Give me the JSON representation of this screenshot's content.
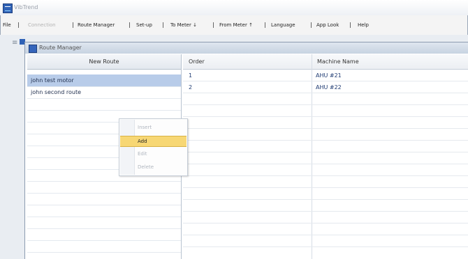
{
  "app": {
    "title": "VibTrend"
  },
  "menu": {
    "file": "File",
    "connection": "Connection",
    "route_manager": "Route Manager",
    "setup": "Set-up",
    "to_meter": "To Meter ↓",
    "from_meter": "From Meter ↑",
    "language": "Language",
    "app_look": "App Look",
    "help": "Help",
    "separator": "|"
  },
  "window": {
    "title": "Route Manager"
  },
  "routes": {
    "header": "New Route",
    "items": [
      {
        "label": "john test motor",
        "selected": true
      },
      {
        "label": "john second route",
        "selected": false
      }
    ]
  },
  "grid": {
    "columns": [
      "Order",
      "Machine Name"
    ],
    "rows": [
      {
        "order": "1",
        "machine": "AHU #21"
      },
      {
        "order": "2",
        "machine": "AHU #22"
      }
    ]
  },
  "context_menu": {
    "items": [
      {
        "label": "Insert",
        "enabled": false,
        "hover": false
      },
      {
        "label": "Add",
        "enabled": true,
        "hover": true
      },
      {
        "label": "Edit",
        "enabled": false,
        "hover": false
      },
      {
        "label": "Delete",
        "enabled": false,
        "hover": false
      }
    ]
  },
  "colors": {
    "selection": "#b8cce9",
    "hover": "#f7d774",
    "accent": "#2f62b6"
  }
}
